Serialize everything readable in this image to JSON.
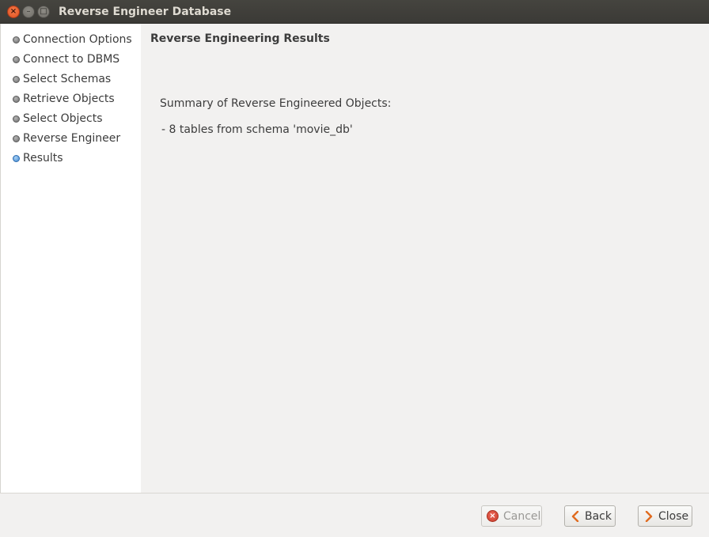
{
  "window": {
    "title": "Reverse Engineer Database",
    "controls": {
      "close_glyph": "×",
      "minimize_glyph": "–",
      "maximize_glyph": "□"
    }
  },
  "sidebar": {
    "steps": [
      {
        "label": "Connection Options",
        "active": false
      },
      {
        "label": "Connect to DBMS",
        "active": false
      },
      {
        "label": "Select Schemas",
        "active": false
      },
      {
        "label": "Retrieve Objects",
        "active": false
      },
      {
        "label": "Select Objects",
        "active": false
      },
      {
        "label": "Reverse Engineer",
        "active": false
      },
      {
        "label": "Results",
        "active": true
      }
    ]
  },
  "main": {
    "heading": "Reverse Engineering Results",
    "summary_label": "Summary of Reverse Engineered Objects:",
    "detail_line": "- 8 tables from schema 'movie_db'"
  },
  "footer": {
    "cancel_label": "Cancel",
    "back_label": "Back",
    "close_label": "Close"
  },
  "colors": {
    "titlebar": "#3c3b37",
    "active_step_bullet": "#3f86d0",
    "chevron": "#e06b1f"
  }
}
